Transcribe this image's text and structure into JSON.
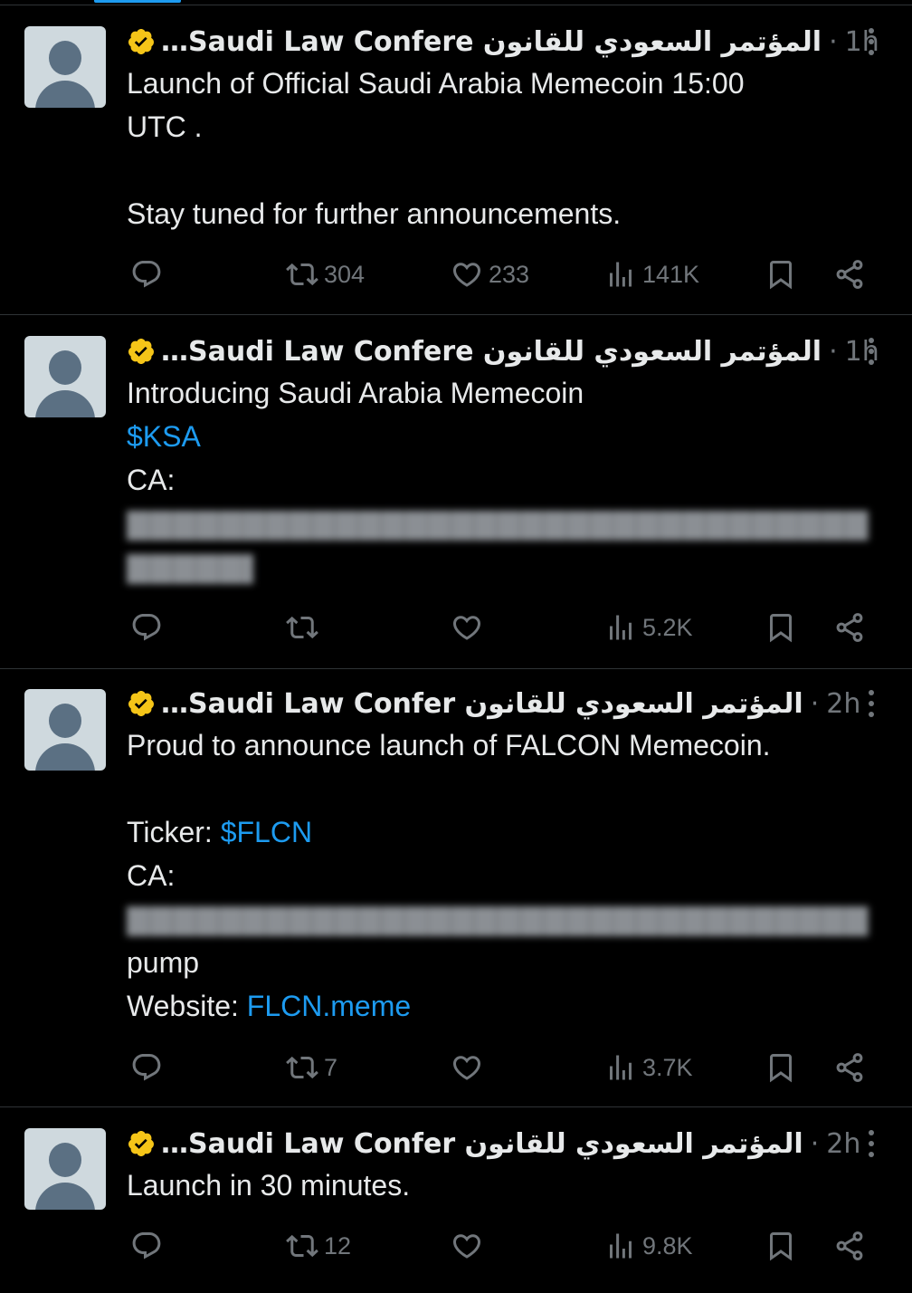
{
  "colors": {
    "background": "#000000",
    "text": "#e7e9ea",
    "muted": "#71767b",
    "link": "#1d9bf0",
    "verified_badge": "#f5c518"
  },
  "tweets": [
    {
      "author": "المؤتمر السعودي للقانون Saudi Law Confere…",
      "time": "1h",
      "lines": [
        "Launch of Official Saudi Arabia Memecoin 15:00",
        "UTC .",
        "",
        "Stay tuned for further announcements."
      ],
      "reply_count": "",
      "retweet_count": "304",
      "like_count": "233",
      "view_count": "141K"
    },
    {
      "author": "المؤتمر السعودي للقانون Saudi Law Confere…",
      "time": "1h",
      "line1": "Introducing Saudi Arabia Memecoin",
      "cashtag": "$KSA",
      "ca_label": "CA:",
      "reply_count": "",
      "retweet_count": "",
      "like_count": "",
      "view_count": "5.2K"
    },
    {
      "author": "المؤتمر السعودي للقانون Saudi Law Confer…",
      "time": "2h",
      "line1": "Proud to announce launch of FALCON Memecoin.",
      "ticker_label": "Ticker: ",
      "cashtag": "$FLCN",
      "ca_label": "CA:",
      "pump": "pump",
      "website_label": "Website: ",
      "website": "FLCN.meme",
      "reply_count": "",
      "retweet_count": "7",
      "like_count": "",
      "view_count": "3.7K"
    },
    {
      "author": "المؤتمر السعودي للقانون Saudi Law Confer…",
      "time": "2h",
      "line1": "Launch in 30 minutes.",
      "reply_count": "",
      "retweet_count": "12",
      "like_count": "",
      "view_count": "9.8K"
    }
  ],
  "separator": "·",
  "icons": [
    "verified-badge-icon",
    "more-icon",
    "reply-icon",
    "retweet-icon",
    "like-icon",
    "views-icon",
    "bookmark-icon",
    "share-icon"
  ]
}
